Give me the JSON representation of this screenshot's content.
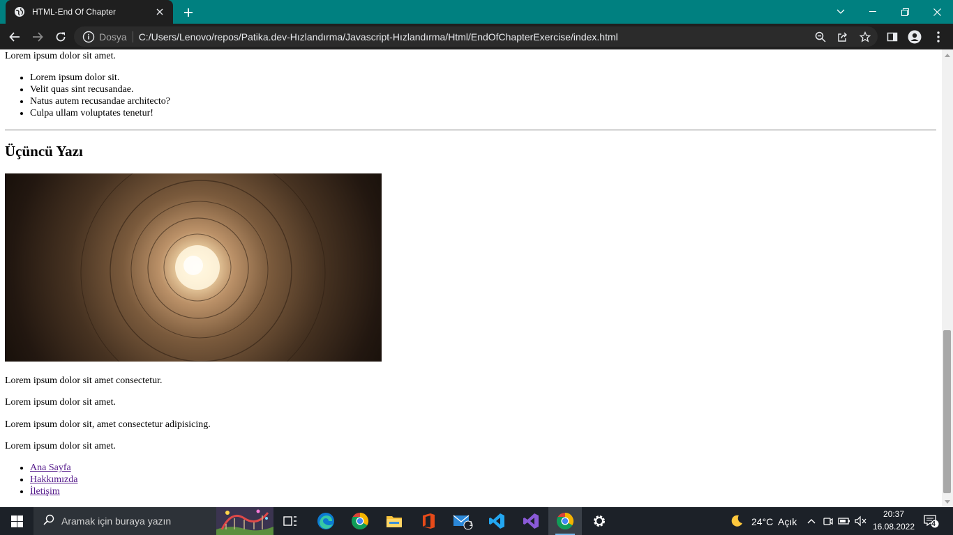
{
  "browser": {
    "tab_title": "HTML-End Of Chapter",
    "security_label": "Dosya",
    "url": "C:/Users/Lenovo/repos/Patika.dev-Hızlandırma/Javascript-Hızlandırma/Html/EndOfChapterExercise/index.html",
    "accent_color": "#008080"
  },
  "page": {
    "top_paragraph": "Lorem ipsum dolor sit amet.",
    "list_items": [
      "Lorem ipsum dolor sit.",
      "Velit quas sint recusandae.",
      "Natus autem recusandae architecto?",
      "Culpa ullam voluptates tenetur!"
    ],
    "heading": "Üçüncü Yazı",
    "paragraphs": [
      "Lorem ipsum dolor sit amet consectetur.",
      "Lorem ipsum dolor sit amet.",
      "Lorem ipsum dolor sit, amet consectetur adipisicing.",
      "Lorem ipsum dolor sit amet."
    ],
    "nav_links": [
      "Ana Sayfa",
      "Hakkımızda",
      "İletişim"
    ],
    "link_color": "#551a8b"
  },
  "taskbar": {
    "search_placeholder": "Aramak için buraya yazın",
    "mail_badge": "1",
    "weather_temp": "24°C",
    "weather_desc": "Açık",
    "time": "20:37",
    "date": "16.08.2022",
    "notification_count": "4"
  }
}
